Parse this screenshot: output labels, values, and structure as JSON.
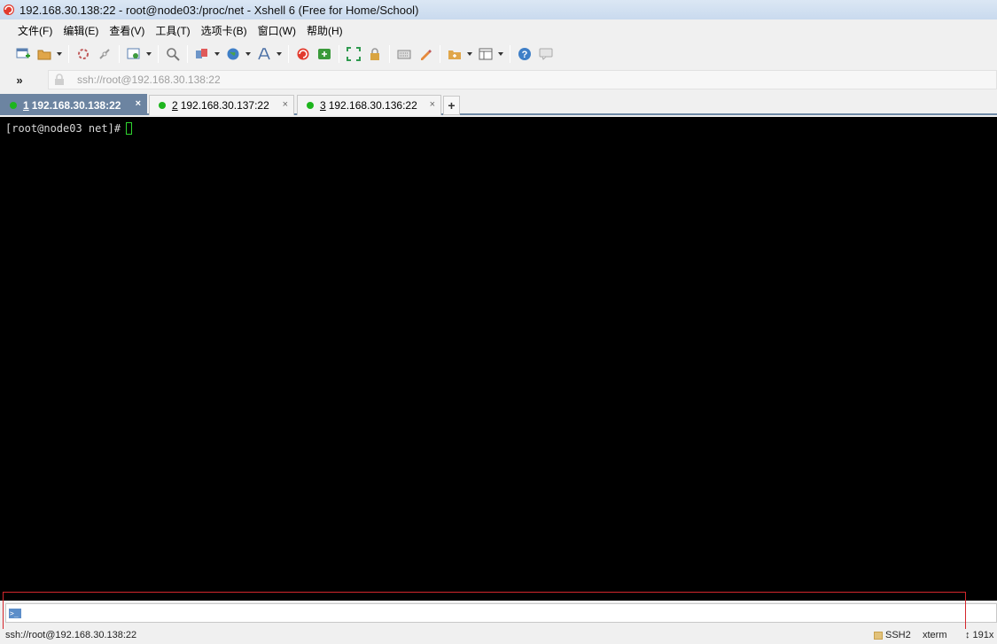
{
  "window": {
    "title": "192.168.30.138:22 - root@node03:/proc/net - Xshell 6 (Free for Home/School)"
  },
  "menu": [
    "文件(F)",
    "编辑(E)",
    "查看(V)",
    "工具(T)",
    "选项卡(B)",
    "窗口(W)",
    "帮助(H)"
  ],
  "address": {
    "expand": "»",
    "url": "ssh://root@192.168.30.138:22"
  },
  "tabs": [
    {
      "num": "1",
      "label": "192.168.30.138:22",
      "active": true,
      "close": "×"
    },
    {
      "num": "2",
      "label": "192.168.30.137:22",
      "active": false,
      "close": "×"
    },
    {
      "num": "3",
      "label": "192.168.30.136:22",
      "active": false,
      "close": "×"
    }
  ],
  "tab_add": "+",
  "terminal": {
    "prompt": "[root@node03 net]#"
  },
  "compose": {
    "icon_text": ">_"
  },
  "status": {
    "connection": "ssh://root@192.168.30.138:22",
    "protocol": "SSH2",
    "terminal_type": "xterm",
    "size": "↕ 191x"
  },
  "colors": {
    "active_tab": "#6c84a1",
    "connected_dot": "#1db51d",
    "cursor": "#2fd52f",
    "highlight_box": "#d4262c"
  }
}
